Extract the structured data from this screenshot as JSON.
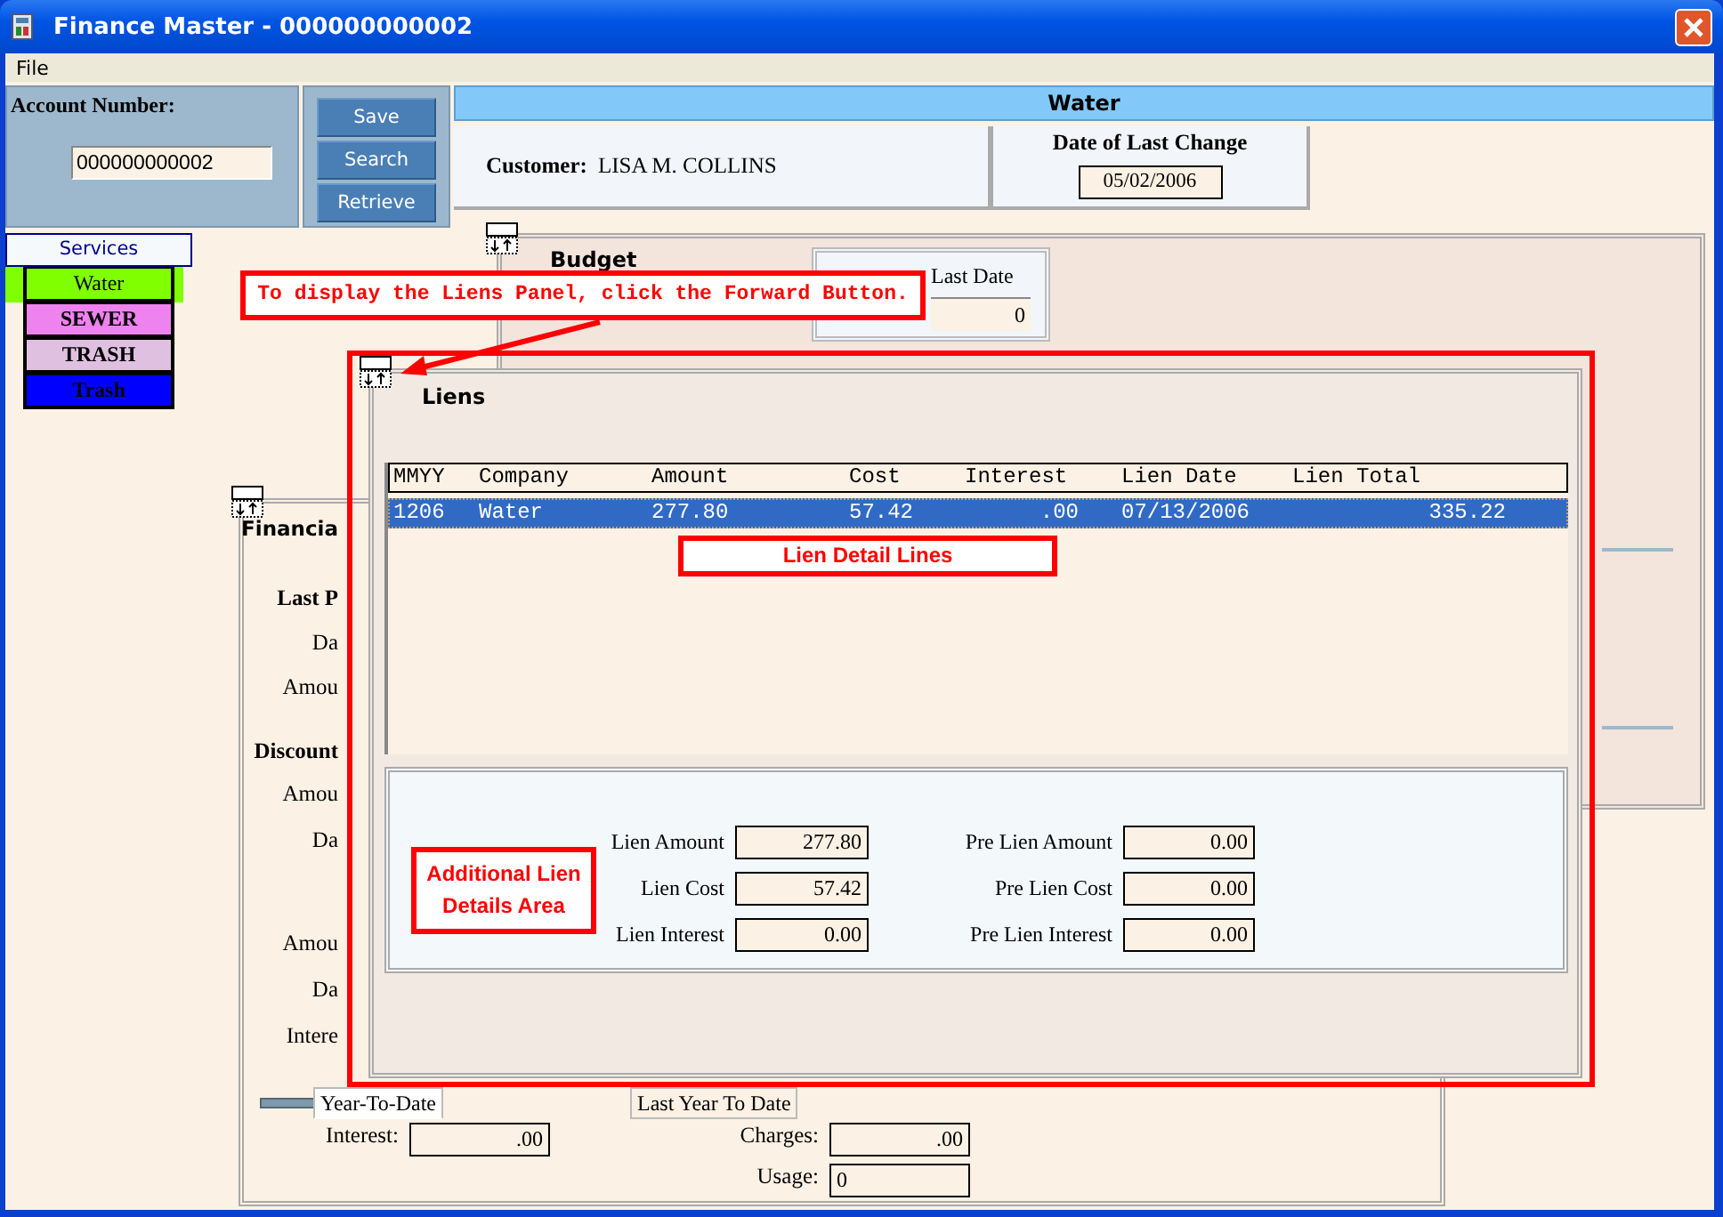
{
  "window": {
    "title": "Finance Master - 000000000002"
  },
  "menu": [
    "File"
  ],
  "account": {
    "label": "Account Number:",
    "value": "000000000002"
  },
  "buttons": [
    "Save",
    "Search",
    "Retrieve"
  ],
  "service_header": "Water",
  "customer": {
    "label": "Customer:",
    "name": "LISA M. COLLINS"
  },
  "last_change": {
    "label": "Date of Last Change",
    "value": "05/02/2006"
  },
  "services": {
    "title": "Services",
    "items": [
      {
        "label": "Water",
        "color": "#80ff00",
        "selected": true
      },
      {
        "label": "SEWER",
        "color": "#ee82ee",
        "selected": false
      },
      {
        "label": "TRASH",
        "color": "#e0c0e0",
        "selected": false
      },
      {
        "label": "Trash",
        "color": "#0000ff",
        "selected": false
      }
    ]
  },
  "budget_panel": {
    "title": "Budget",
    "last_date": {
      "label": "Last Date",
      "value": "0"
    }
  },
  "financial_panel": {
    "labels": [
      {
        "text": "Financia",
        "kind": "heading"
      },
      {
        "text": "Last P",
        "kind": "subheading"
      },
      {
        "text": "Da",
        "kind": "label"
      },
      {
        "text": "Amou",
        "kind": "label"
      },
      {
        "text": "Discount",
        "kind": "subheading"
      },
      {
        "text": "Amou",
        "kind": "label"
      },
      {
        "text": "Da",
        "kind": "label"
      },
      {
        "text": "Amou",
        "kind": "label"
      },
      {
        "text": "Da",
        "kind": "label"
      },
      {
        "text": "Intere",
        "kind": "label"
      }
    ],
    "tabs": [
      {
        "label": "Year-To-Date",
        "selected": true
      },
      {
        "label": "Last Year To Date",
        "selected": false
      }
    ],
    "fields": [
      {
        "label": "Interest:",
        "value": ".00"
      },
      {
        "label": "Charges:",
        "value": ".00"
      },
      {
        "label": "Usage:",
        "value": "0"
      }
    ]
  },
  "liens_panel": {
    "title": "Liens",
    "table": {
      "columns": [
        "MMYY",
        "Company",
        "Amount",
        "Cost",
        "Interest",
        "Lien Date",
        "Lien Total"
      ],
      "rows": [
        {
          "cells": [
            "1206",
            "Water",
            "277.80",
            "57.42",
            ".00",
            "07/13/2006",
            "335.22"
          ],
          "selected": true
        }
      ]
    },
    "details": [
      {
        "label": "Lien Amount",
        "value": "277.80"
      },
      {
        "label": "Pre Lien Amount",
        "value": "0.00"
      },
      {
        "label": "Lien Cost",
        "value": "57.42"
      },
      {
        "label": "Pre Lien Cost",
        "value": "0.00"
      },
      {
        "label": "Lien Interest",
        "value": "0.00"
      },
      {
        "label": "Pre Lien Interest",
        "value": "0.00"
      }
    ]
  },
  "annotations": [
    {
      "kind": "instruction",
      "text": "To display the Liens Panel, click the Forward Button."
    },
    {
      "kind": "table-note",
      "text": "Lien Detail Lines"
    },
    {
      "kind": "details-note",
      "text": "Additional Lien Details Area"
    }
  ]
}
